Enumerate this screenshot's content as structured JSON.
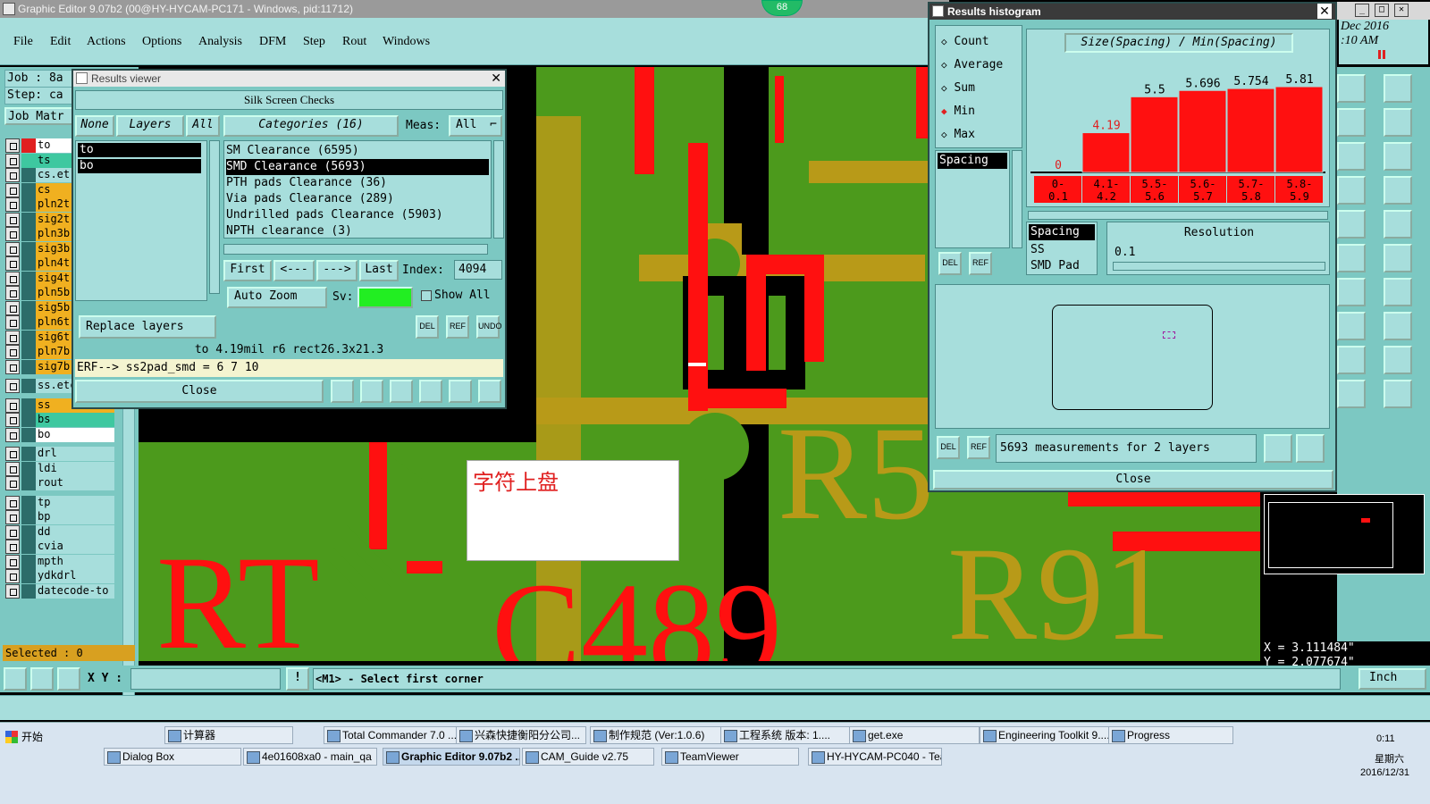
{
  "window_title": "Graphic Editor 9.07b2 (00@HY-HYCAM-PC171 - Windows, pid:11712)",
  "badge": "68",
  "menu": [
    "File",
    "Edit",
    "Actions",
    "Options",
    "Analysis",
    "DFM",
    "Step",
    "Rout",
    "Windows"
  ],
  "job": {
    "job_label": "Job : 8a",
    "step_label": "Step: ca",
    "matrix_label": "Job Matr"
  },
  "layers": [
    {
      "name": "to",
      "color": "#ffffff"
    },
    {
      "name": "ts",
      "color": "#3ec8a0"
    },
    {
      "name": "cs.et",
      "color": "#a7dedc"
    },
    {
      "name": "cs",
      "color": "#f0b020"
    },
    {
      "name": "pln2t",
      "color": "#f0b020"
    },
    {
      "name": "sig2t",
      "color": "#f0b020"
    },
    {
      "name": "pln3b",
      "color": "#f0b020"
    },
    {
      "name": "sig3b",
      "color": "#f0b020"
    },
    {
      "name": "pln4t",
      "color": "#f0b020"
    },
    {
      "name": "sig4t",
      "color": "#f0b020"
    },
    {
      "name": "pln5b",
      "color": "#f0b020"
    },
    {
      "name": "sig5b",
      "color": "#f0b020"
    },
    {
      "name": "pln6t",
      "color": "#f0b020"
    },
    {
      "name": "sig6t",
      "color": "#f0b020"
    },
    {
      "name": "pln7b",
      "color": "#f0b020"
    },
    {
      "name": "sig7b",
      "color": "#f0b020"
    },
    {
      "name": "ss.etch",
      "color": "#a7dedc"
    },
    {
      "name": "ss",
      "color": "#f0b020"
    },
    {
      "name": "bs",
      "color": "#3ec8a0"
    },
    {
      "name": "bo",
      "color": "#ffffff"
    },
    {
      "name": "drl",
      "color": "#a7dedc"
    },
    {
      "name": "ldi",
      "color": "#a7dedc"
    },
    {
      "name": "rout",
      "color": "#a7dedc"
    },
    {
      "name": "tp",
      "color": "#a7dedc"
    },
    {
      "name": "bp",
      "color": "#a7dedc"
    },
    {
      "name": "dd",
      "color": "#a7dedc"
    },
    {
      "name": "cvia",
      "color": "#a7dedc"
    },
    {
      "name": "mpth",
      "color": "#a7dedc"
    },
    {
      "name": "ydkdrl",
      "color": "#a7dedc"
    },
    {
      "name": "datecode-to",
      "color": "#a7dedc"
    }
  ],
  "selected": "Selected : 0",
  "results_viewer": {
    "title": "Results viewer",
    "header": "Silk Screen Checks",
    "none": "None",
    "layers": "Layers",
    "all": "All",
    "layer_list": [
      "to",
      "bo"
    ],
    "categories": "Categories (16)",
    "meas_label": "Meas:",
    "meas_value": "All",
    "category_list": [
      "SM Clearance (6595)",
      "SMD Clearance (5693)",
      "PTH pads Clearance (36)",
      "Via pads Clearance (289)",
      "Undrilled pads Clearance (5903)",
      "NPTH clearance (3)"
    ],
    "first": "First",
    "prev": "<---",
    "next": "--->",
    "last": "Last",
    "index_label": "Index:",
    "index_value": "4094",
    "auto_zoom": "Auto Zoom",
    "sv": "Sv:",
    "show_all": "Show All",
    "replace_layers": "Replace layers",
    "del": "DEL",
    "ref": "REF",
    "undo": "UNDO",
    "info": "to 4.19mil  r6  rect26.3x21.3",
    "erf": "ERF--> ss2pad_smd = 6 7 10",
    "close": "Close"
  },
  "results_histogram": {
    "title": "Results histogram",
    "options": [
      "Count",
      "Average",
      "Sum",
      "Min",
      "Max"
    ],
    "selected_option": "Min",
    "header": "Size(Spacing) / Min(Spacing)",
    "bar_labels": [
      "0",
      "4.19",
      "5.5",
      "5.696",
      "5.754",
      "5.81"
    ],
    "bar_values": [
      0,
      4.19,
      5.5,
      5.696,
      5.754,
      5.81
    ],
    "bins": [
      "0-\n0.1",
      "4.1-\n4.2",
      "5.5-\n5.6",
      "5.6-\n5.7",
      "5.7-\n5.8",
      "5.8-\n5.9"
    ],
    "left_list": [
      "Spacing"
    ],
    "list2": [
      "Spacing",
      "SS",
      "SMD Pad"
    ],
    "resolution_label": "Resolution",
    "resolution_value": "0.1",
    "measurements": "5693 measurements for 2 layers",
    "del": "DEL",
    "ref": "REF",
    "close": "Close"
  },
  "clock_fragment": {
    "date": "Dec 2016",
    "time": ":10 AM"
  },
  "canvas": {
    "annotation": "字符上盘",
    "silk_labels": [
      "R5",
      "R91",
      "C489",
      "RT"
    ]
  },
  "coords": {
    "x": "X = 3.111484\"",
    "y": "Y = 2.077674\""
  },
  "status": {
    "xy_label": "X Y :",
    "prompt": "<M1> - Select first corner",
    "units": "Inch"
  },
  "taskbar": {
    "start": "开始",
    "row1": [
      "计算器",
      "Total Commander 7.0 ...",
      "兴森快捷衡阳分公司...",
      "制作规范 (Ver:1.0.6)",
      "工程系统  版本: 1....",
      "get.exe",
      "Engineering Toolkit 9....",
      "Progress"
    ],
    "row2": [
      "Dialog Box",
      "4e01608xa0 - main_qa",
      "Graphic Editor 9.07b2 ...",
      "CAM_Guide v2.75",
      "TeamViewer",
      "HY-HYCAM-PC040 - Tea..."
    ],
    "active": "Graphic Editor 9.07b2 ...",
    "clock_time": "0:11",
    "clock_day": "星期六",
    "clock_date": "2016/12/31"
  },
  "colors": {
    "accent": "#a7dedc",
    "panel": "#7cc8c2",
    "pcb_green": "#4c9a1c",
    "pcb_red": "#ff1010",
    "pcb_olive": "#b89a18"
  }
}
